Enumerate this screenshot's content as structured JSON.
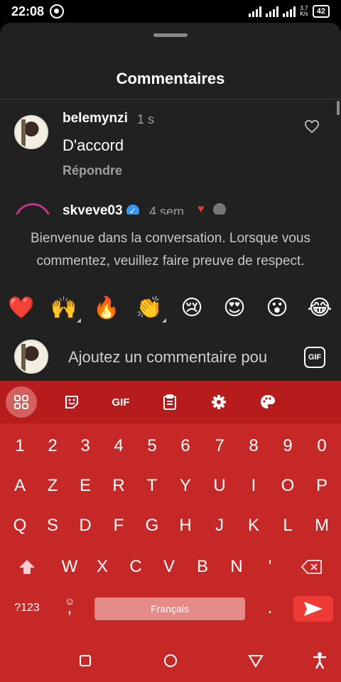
{
  "status_bar": {
    "time": "22:08",
    "net_speed_value": "3,7",
    "net_speed_unit": "K/s",
    "battery": "42"
  },
  "sheet": {
    "title": "Commentaires"
  },
  "comments": [
    {
      "user": "belemynzi",
      "time": "1 s",
      "text": "D'accord",
      "reply_label": "Répondre"
    },
    {
      "user": "skyeye03",
      "time": "4 sem."
    }
  ],
  "welcome_text": "Bienvenue dans la conversation. Lorsque vous commentez, veuillez faire preuve de respect.",
  "emojis": [
    "❤️",
    "🙌",
    "🔥",
    "👏",
    "😢",
    "😍",
    "😮",
    "😂"
  ],
  "composer": {
    "placeholder": "Ajoutez un commentaire pou",
    "gif_label": "GIF"
  },
  "keyboard": {
    "toolbar_gif": "GIF",
    "rows": [
      [
        "1",
        "2",
        "3",
        "4",
        "5",
        "6",
        "7",
        "8",
        "9",
        "0"
      ],
      [
        "A",
        "Z",
        "E",
        "R",
        "T",
        "Y",
        "U",
        "I",
        "O",
        "P"
      ],
      [
        "Q",
        "S",
        "D",
        "F",
        "G",
        "H",
        "J",
        "K",
        "L",
        "M"
      ],
      [
        "W",
        "X",
        "C",
        "V",
        "B",
        "N",
        "'"
      ]
    ],
    "symbols_key": "?123",
    "emoji_comma": ",",
    "space_label": "Français",
    "period": "."
  },
  "colors": {
    "sheet_bg": "#212121",
    "keyboard_bg": "#c62828",
    "toolbar_bg": "#b71c1c",
    "send_bg": "#ef3b36"
  }
}
